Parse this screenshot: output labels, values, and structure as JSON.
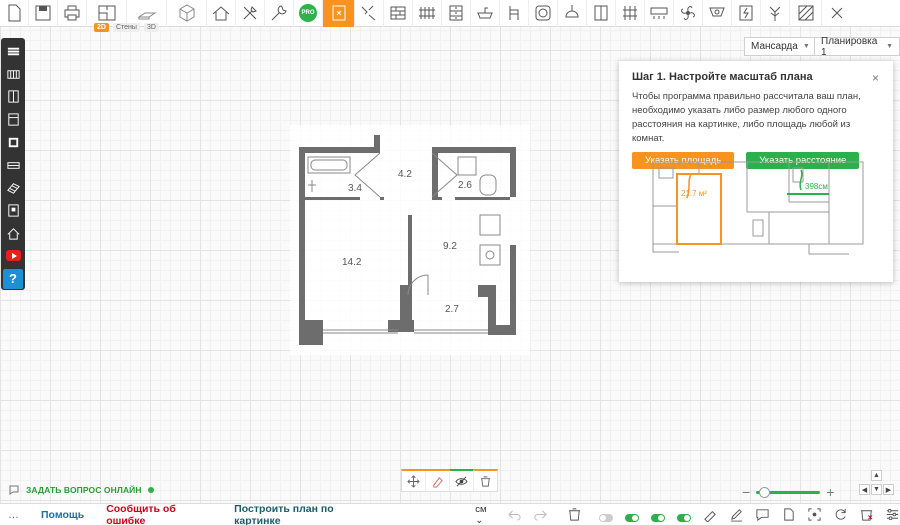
{
  "toolbar": {
    "view_modes": [
      "2D",
      "Стены",
      "3D"
    ],
    "pro_badge": "PRO",
    "tools": [
      "doc-icon",
      "save-icon",
      "print-icon",
      "plan-2d-icon",
      "walls-icon",
      "view-3d-icon",
      "roof-icon",
      "tools-icon",
      "wrench-icon",
      "pro-icon",
      "door-icon",
      "pipes-icon",
      "bricks-icon",
      "radiator-icon",
      "furniture-icon",
      "sink-icon",
      "chair-icon",
      "socket-icon",
      "lamp-icon",
      "wardrobe-icon",
      "floor-heating-icon",
      "ac-icon",
      "fan-icon",
      "camera-icon",
      "electric-icon",
      "plant-icon",
      "texture-icon"
    ],
    "active_tool": "door-icon"
  },
  "left_panel": [
    "layers-icon",
    "wall-icon",
    "door-icon",
    "window-icon",
    "floor-icon",
    "baseboard-icon",
    "material-icon",
    "building-icon",
    "house-icon",
    "youtube-icon",
    "help-icon"
  ],
  "help_label": "?",
  "floor_select": "Мансарда",
  "plan_select": "Планировка 1",
  "plan": {
    "rooms": [
      {
        "label": "3.4"
      },
      {
        "label": "4.2"
      },
      {
        "label": "2.6"
      },
      {
        "label": "14.2"
      },
      {
        "label": "9.2"
      },
      {
        "label": "2.7"
      }
    ]
  },
  "dialog": {
    "title": "Шаг 1. Настройте масштаб плана",
    "text": "Чтобы программа правильно рассчитала ваш план, необходимо указать либо размер любого одного расстояния на картинке, либо площадь любой из комнат.",
    "btn_area": "Указать площадь",
    "btn_distance": "Указать расстояние",
    "example_area": "21.7 м²",
    "example_distance": "398см",
    "close": "×"
  },
  "chat": {
    "label": "ЗАДАТЬ ВОПРОС ОНЛАЙН"
  },
  "bottom": {
    "help": "Помощь",
    "report": "Сообщить об ошибке",
    "build": "Построить план по картинке",
    "unit": "см"
  },
  "zoom": {
    "level": 0.05
  },
  "colors": {
    "orange": "#f7931e",
    "green": "#2bb14b",
    "red_link": "#d0021b",
    "blue_link": "#1b6ea8",
    "teal_link": "#1a5c6b"
  }
}
